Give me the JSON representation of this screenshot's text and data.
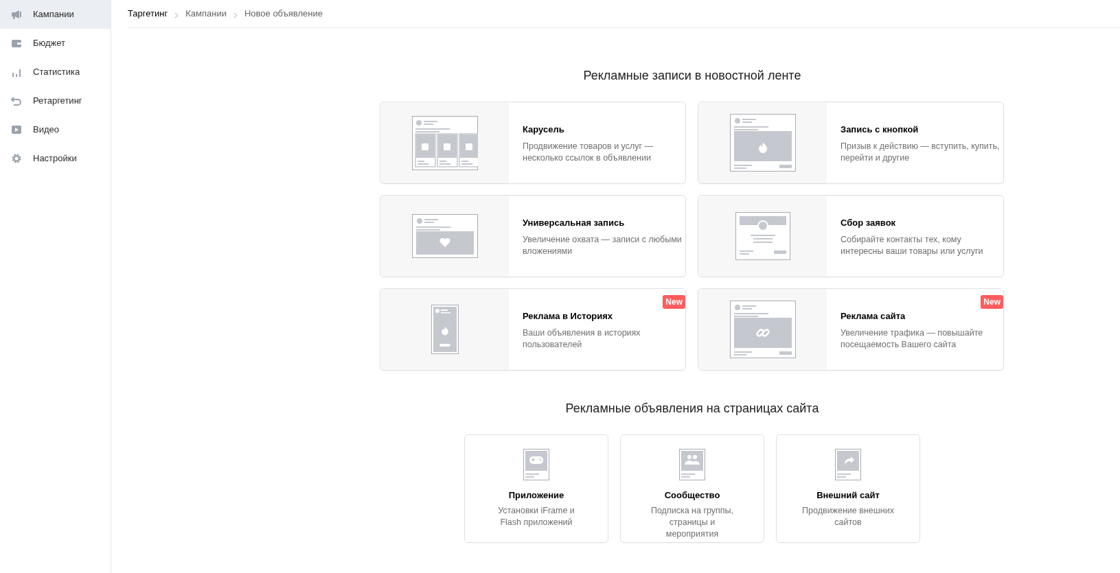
{
  "sidebar": {
    "items": [
      {
        "label": "Кампании",
        "selected": true
      },
      {
        "label": "Бюджет",
        "selected": false
      },
      {
        "label": "Статистика",
        "selected": false
      },
      {
        "label": "Ретаргетинг",
        "selected": false
      },
      {
        "label": "Видео",
        "selected": false
      },
      {
        "label": "Настройки",
        "selected": false
      }
    ]
  },
  "breadcrumbs": [
    "Таргетинг",
    "Кампании",
    "Новое объявление"
  ],
  "feed_section": {
    "title": "Рекламные записи в новостной ленте",
    "cards": [
      {
        "kind": "carousel",
        "title": "Карусель",
        "description": "Продвижение товаров и услуг — несколько ссылок в объявлении",
        "new": false
      },
      {
        "kind": "button",
        "title": "Запись с кнопкой",
        "description": "Призыв к действию — вступить, купить, перейти и другие",
        "new": false
      },
      {
        "kind": "universal",
        "title": "Универсальная запись",
        "description": "Увеличение охвата — записи с любыми вложениями",
        "new": false
      },
      {
        "kind": "leads",
        "title": "Сбор заявок",
        "description": "Собирайте контакты тех, кому интересны ваши товары или услуги",
        "new": false
      },
      {
        "kind": "stories",
        "title": "Реклама в Историях",
        "description": "Ваши объявления в историях пользователей",
        "new": true,
        "badge": "New"
      },
      {
        "kind": "site",
        "title": "Реклама сайта",
        "description": "Увеличение трафика — повышайте посещаемость Вашего сайта",
        "new": true,
        "badge": "New"
      }
    ]
  },
  "site_section": {
    "title": "Рекламные объявления на страницах сайта",
    "cards": [
      {
        "kind": "app",
        "title": "Приложение",
        "description": "Установки iFrame и Flash приложений"
      },
      {
        "kind": "community",
        "title": "Сообщество",
        "description": "Подписка на группы, страницы и мероприятия"
      },
      {
        "kind": "external",
        "title": "Внешний сайт",
        "description": "Продвижение внешних сайтов"
      }
    ]
  }
}
